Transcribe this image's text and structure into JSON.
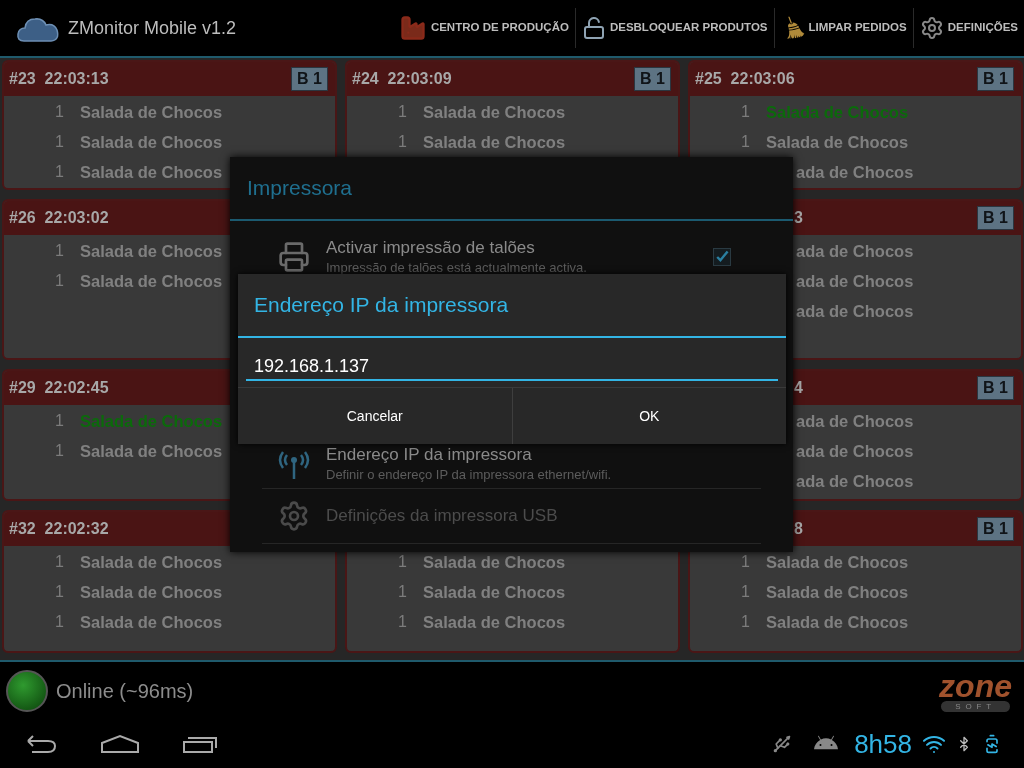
{
  "app_bar": {
    "title": "ZMonitor Mobile v1.2",
    "actions": [
      {
        "label": "CENTRO DE PRODUÇÃO",
        "kind": "factory"
      },
      {
        "label": "DESBLOQUEAR PRODUTOS",
        "kind": "lock"
      },
      {
        "label": "LIMPAR PEDIDOS",
        "kind": "broom"
      },
      {
        "label": "DEFINIÇÕES",
        "kind": "gear"
      }
    ]
  },
  "order_rows": [
    [
      {
        "title": "#23  22:03:13",
        "badge": "B 1",
        "covered": false,
        "items": [
          {
            "qty": "1",
            "name": "Salada de Chocos",
            "done": false
          },
          {
            "qty": "1",
            "name": "Salada de Chocos",
            "done": false
          },
          {
            "qty": "1",
            "name": "Salada de Chocos",
            "done": false
          }
        ]
      },
      {
        "title": "#24  22:03:09",
        "badge": "B 1",
        "covered": false,
        "items": [
          {
            "qty": "1",
            "name": "Salada de Chocos",
            "done": false
          },
          {
            "qty": "1",
            "name": "Salada de Chocos",
            "done": false
          }
        ]
      },
      {
        "title": "#25  22:03:06",
        "badge": "B 1",
        "covered": false,
        "items": [
          {
            "qty": "1",
            "name": "Salada de Chocos",
            "done": true
          },
          {
            "qty": "1",
            "name": "Salada de Chocos",
            "done": false
          },
          {
            "name": "ada de Chocos",
            "done": false
          }
        ]
      }
    ],
    [
      {
        "title": "#26  22:03:02",
        "covered": false,
        "items": [
          {
            "qty": "1",
            "name": "Salada de Chocos",
            "done": false
          },
          {
            "qty": "1",
            "name": "Salada de Chocos",
            "done": false
          }
        ]
      },
      null,
      {
        "title": "3",
        "badge": "B 1",
        "covered": true,
        "items": [
          {
            "name": "ada de Chocos",
            "done": false
          },
          {
            "name": "ada de Chocos",
            "done": false
          },
          {
            "name": "ada de Chocos",
            "done": false
          }
        ]
      }
    ],
    [
      {
        "title": "#29  22:02:45",
        "covered": false,
        "items": [
          {
            "qty": "1",
            "name": "Salada de Chocos",
            "done": true
          },
          {
            "qty": "1",
            "name": "Salada de Chocos",
            "done": false
          }
        ]
      },
      null,
      {
        "title": "4",
        "badge": "B 1",
        "covered": true,
        "items": [
          {
            "name": "ada de Chocos",
            "done": false
          },
          {
            "name": "ada de Chocos",
            "done": false
          },
          {
            "name": "ada de Chocos",
            "done": false
          }
        ]
      }
    ],
    [
      {
        "title": "#32  22:02:32",
        "covered": false,
        "items": [
          {
            "qty": "1",
            "name": "Salada de Chocos",
            "done": false
          },
          {
            "qty": "1",
            "name": "Salada de Chocos",
            "done": false
          },
          {
            "qty": "1",
            "name": "Salada de Chocos",
            "done": false
          }
        ]
      },
      {
        "items": [
          {
            "qty": "1",
            "name": "Salada de Chocos",
            "done": false
          },
          {
            "qty": "1",
            "name": "Salada de Chocos",
            "done": false
          },
          {
            "qty": "1",
            "name": "Salada de Chocos",
            "done": false
          }
        ]
      },
      {
        "title": "8",
        "badge": "B 1",
        "covered": true,
        "items": [
          {
            "qty": "1",
            "name": "Salada de Chocos",
            "done": false
          },
          {
            "qty": "1",
            "name": "Salada de Chocos",
            "done": false
          },
          {
            "qty": "1",
            "name": "Salada de Chocos",
            "done": false
          }
        ]
      }
    ]
  ],
  "status": {
    "online": true,
    "label": "Online (~96ms)"
  },
  "brand": {
    "name": "zone",
    "tagline": "SOFT"
  },
  "printer_dialog": {
    "title": "Impressora",
    "settings": [
      {
        "kind": "printer",
        "title": "Activar impressão de talões",
        "subtitle": "Impressão de talões está actualmente activa.",
        "checked": true,
        "disabled": false
      },
      {
        "kind": "antenna",
        "title": "Endereço IP da impressora",
        "subtitle": "Definir o endereço IP da impressora ethernet/wifi.",
        "disabled": false
      },
      {
        "kind": "gear",
        "title": "Definições da impressora USB",
        "disabled": true
      }
    ]
  },
  "ip_dialog": {
    "title": "Endereço IP da impressora",
    "value": "192.168.1.137",
    "buttons": [
      "Cancelar",
      "OK"
    ]
  },
  "system_bar": {
    "clock": "8h58"
  }
}
